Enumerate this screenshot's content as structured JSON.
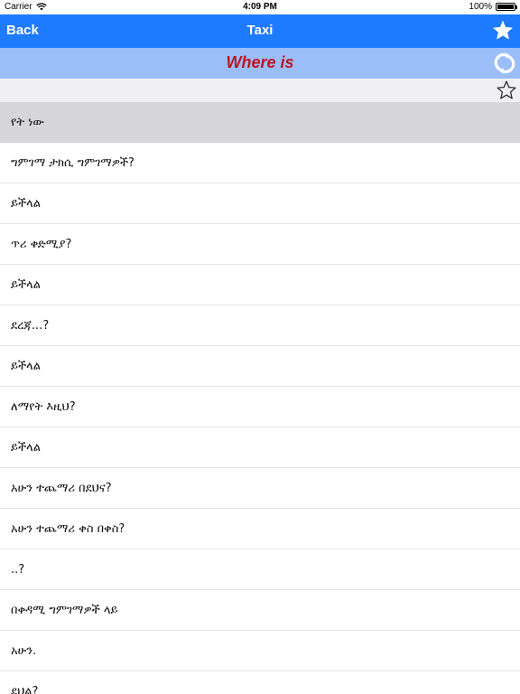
{
  "statusbar": {
    "carrier": "Carrier",
    "time": "4:09 PM",
    "battery": "100%",
    "battery_level": 1.0
  },
  "navbar": {
    "back_label": "Back",
    "title": "Taxi"
  },
  "section": {
    "heading": "Where is"
  },
  "list": {
    "header": "የት ነው",
    "items": [
      "ግምገማ ታክሲ ግምገማዎች?",
      "ይችላል",
      "ጥሪ ቀድሚያ?",
      "ይችላል",
      "ደረጃ...?",
      "ይችላል",
      "ለማየት እዚህ?",
      "ይችላል",
      "አሁን ተጨማሪ በደህና?",
      "አሁን ተጨማሪ ቀስ በቀስ?",
      "..?",
      "በቀዳሚ ግምገማዎች ላይ",
      "አሁን.",
      "ደህል?"
    ]
  },
  "colors": {
    "navbar": "#1e7bff",
    "section": "#9bbef9",
    "heading": "#c0141c",
    "header_row": "#d6d6d8"
  }
}
